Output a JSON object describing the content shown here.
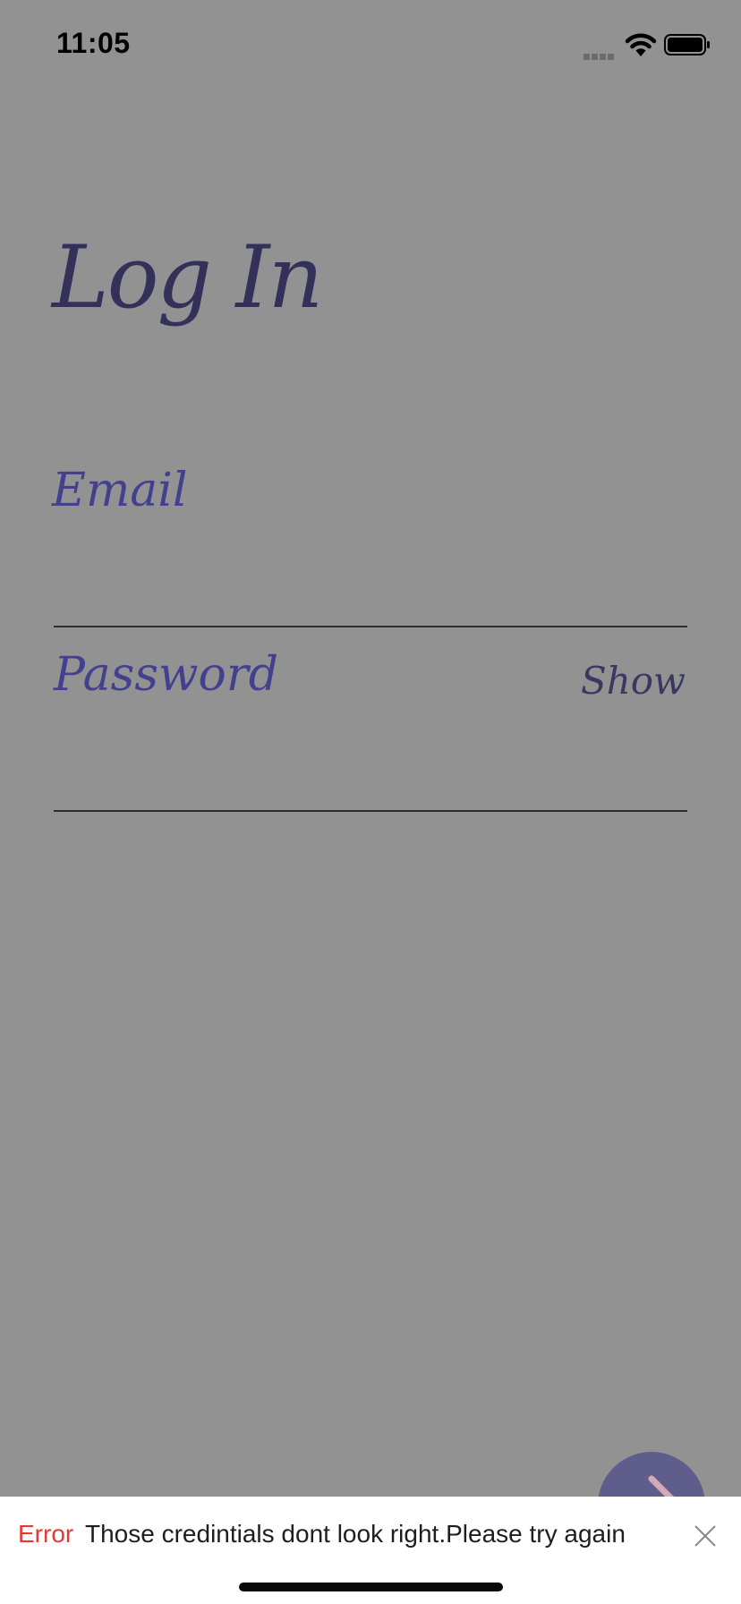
{
  "status_bar": {
    "time": "11:05",
    "icons": [
      "cellular-signal-icon",
      "wifi-icon",
      "battery-icon"
    ]
  },
  "page": {
    "title": "Log In"
  },
  "form": {
    "email": {
      "label": "Email",
      "value": ""
    },
    "password": {
      "label": "Password",
      "value": "",
      "toggle_label": "Show"
    },
    "submit_icon": "arrow-icon"
  },
  "snackbar": {
    "type_label": "Error",
    "message": "Those credintials dont look right.Please try again",
    "close_icon": "close-icon"
  },
  "colors": {
    "background": "#929292",
    "title": "#33315a",
    "label": "#43418f",
    "fab": "#5f5d8c",
    "fab_arrow": "#d6a9b8",
    "error": "#e53935"
  }
}
